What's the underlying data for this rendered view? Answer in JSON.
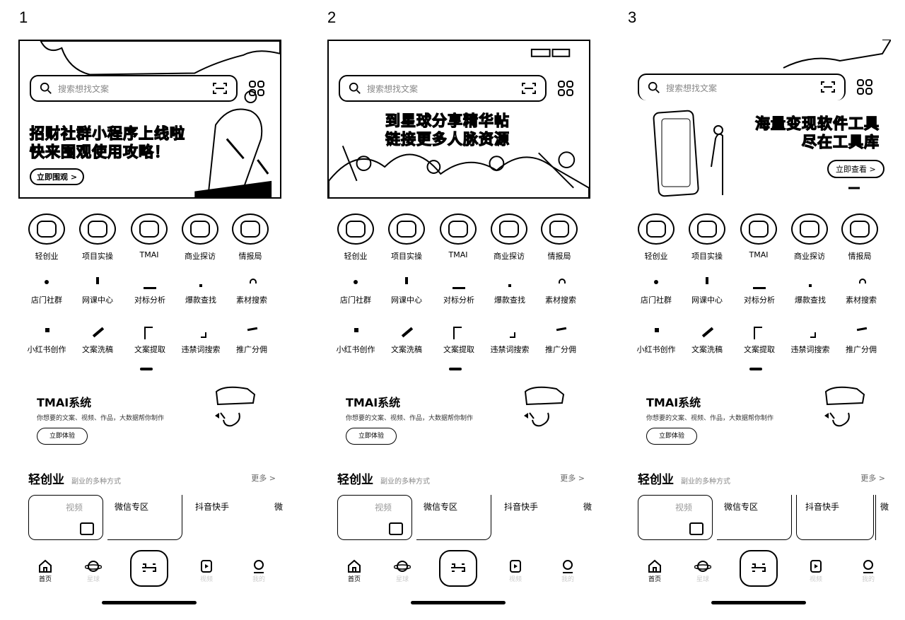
{
  "panels": [
    {
      "index": "1",
      "search_placeholder": "搜索想找文案",
      "banner_line1": "招财社群小程序上线啦",
      "banner_line2": "快来围观使用攻略！",
      "banner_button": "立即围观 >"
    },
    {
      "index": "2",
      "search_placeholder": "搜索想找文案",
      "banner_line1": "到星球分享精华帖",
      "banner_line2": "链接更多人脉资源",
      "banner_button": ""
    },
    {
      "index": "3",
      "search_placeholder": "搜索想找文案",
      "banner_line1": "海量变现软件工具",
      "banner_line2": "尽在工具库",
      "banner_button": "立即查看 >"
    }
  ],
  "categories": [
    "轻创业",
    "项目实操",
    "TMAI",
    "商业探访",
    "情报局"
  ],
  "tools_row1": [
    "店门社群",
    "网课中心",
    "对标分析",
    "爆款查找",
    "素材搜索"
  ],
  "tools_row2": [
    "小红书创作",
    "文案洗稿",
    "文案提取",
    "违禁词搜索",
    "推广分佣"
  ],
  "tmai": {
    "title": "TMAI系统",
    "desc": "你想要的文案、视频、作品，大数据帮你制作",
    "button": "立即体验"
  },
  "section": {
    "title": "轻创业",
    "subtitle": "副业的多种方式",
    "more": "更多 >"
  },
  "cards": [
    "视频",
    "微信专区",
    "抖音快手",
    "微"
  ],
  "tabbar": {
    "home": "首页",
    "planet": "星球",
    "video": "视频",
    "mine": "我的"
  }
}
